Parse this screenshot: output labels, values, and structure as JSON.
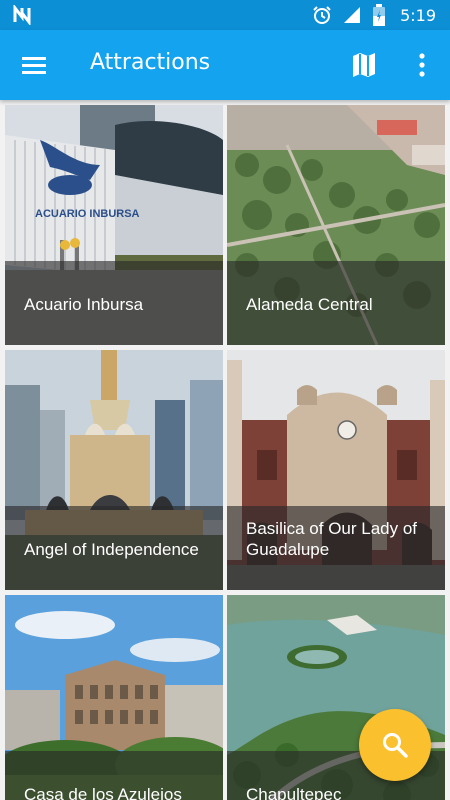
{
  "status_bar": {
    "time": "5:19",
    "icons": [
      "notification-icon",
      "alarm-icon",
      "signal-icon",
      "battery-icon"
    ]
  },
  "app_bar": {
    "title": "Attractions",
    "icons": [
      "menu-icon",
      "map-icon",
      "more-vert-icon"
    ],
    "color": "#13a3ef"
  },
  "attractions": [
    {
      "name": "Acuario Inbursa",
      "sign_text": "ACUARIO INBURSA"
    },
    {
      "name": "Alameda Central"
    },
    {
      "name": "Angel of Independence"
    },
    {
      "name": "Basilica of Our Lady of Guadalupe"
    },
    {
      "name": "Casa de los Azulejos"
    },
    {
      "name": "Chapultepec"
    }
  ],
  "fab": {
    "icon": "search-icon",
    "color": "#fbc02d"
  }
}
